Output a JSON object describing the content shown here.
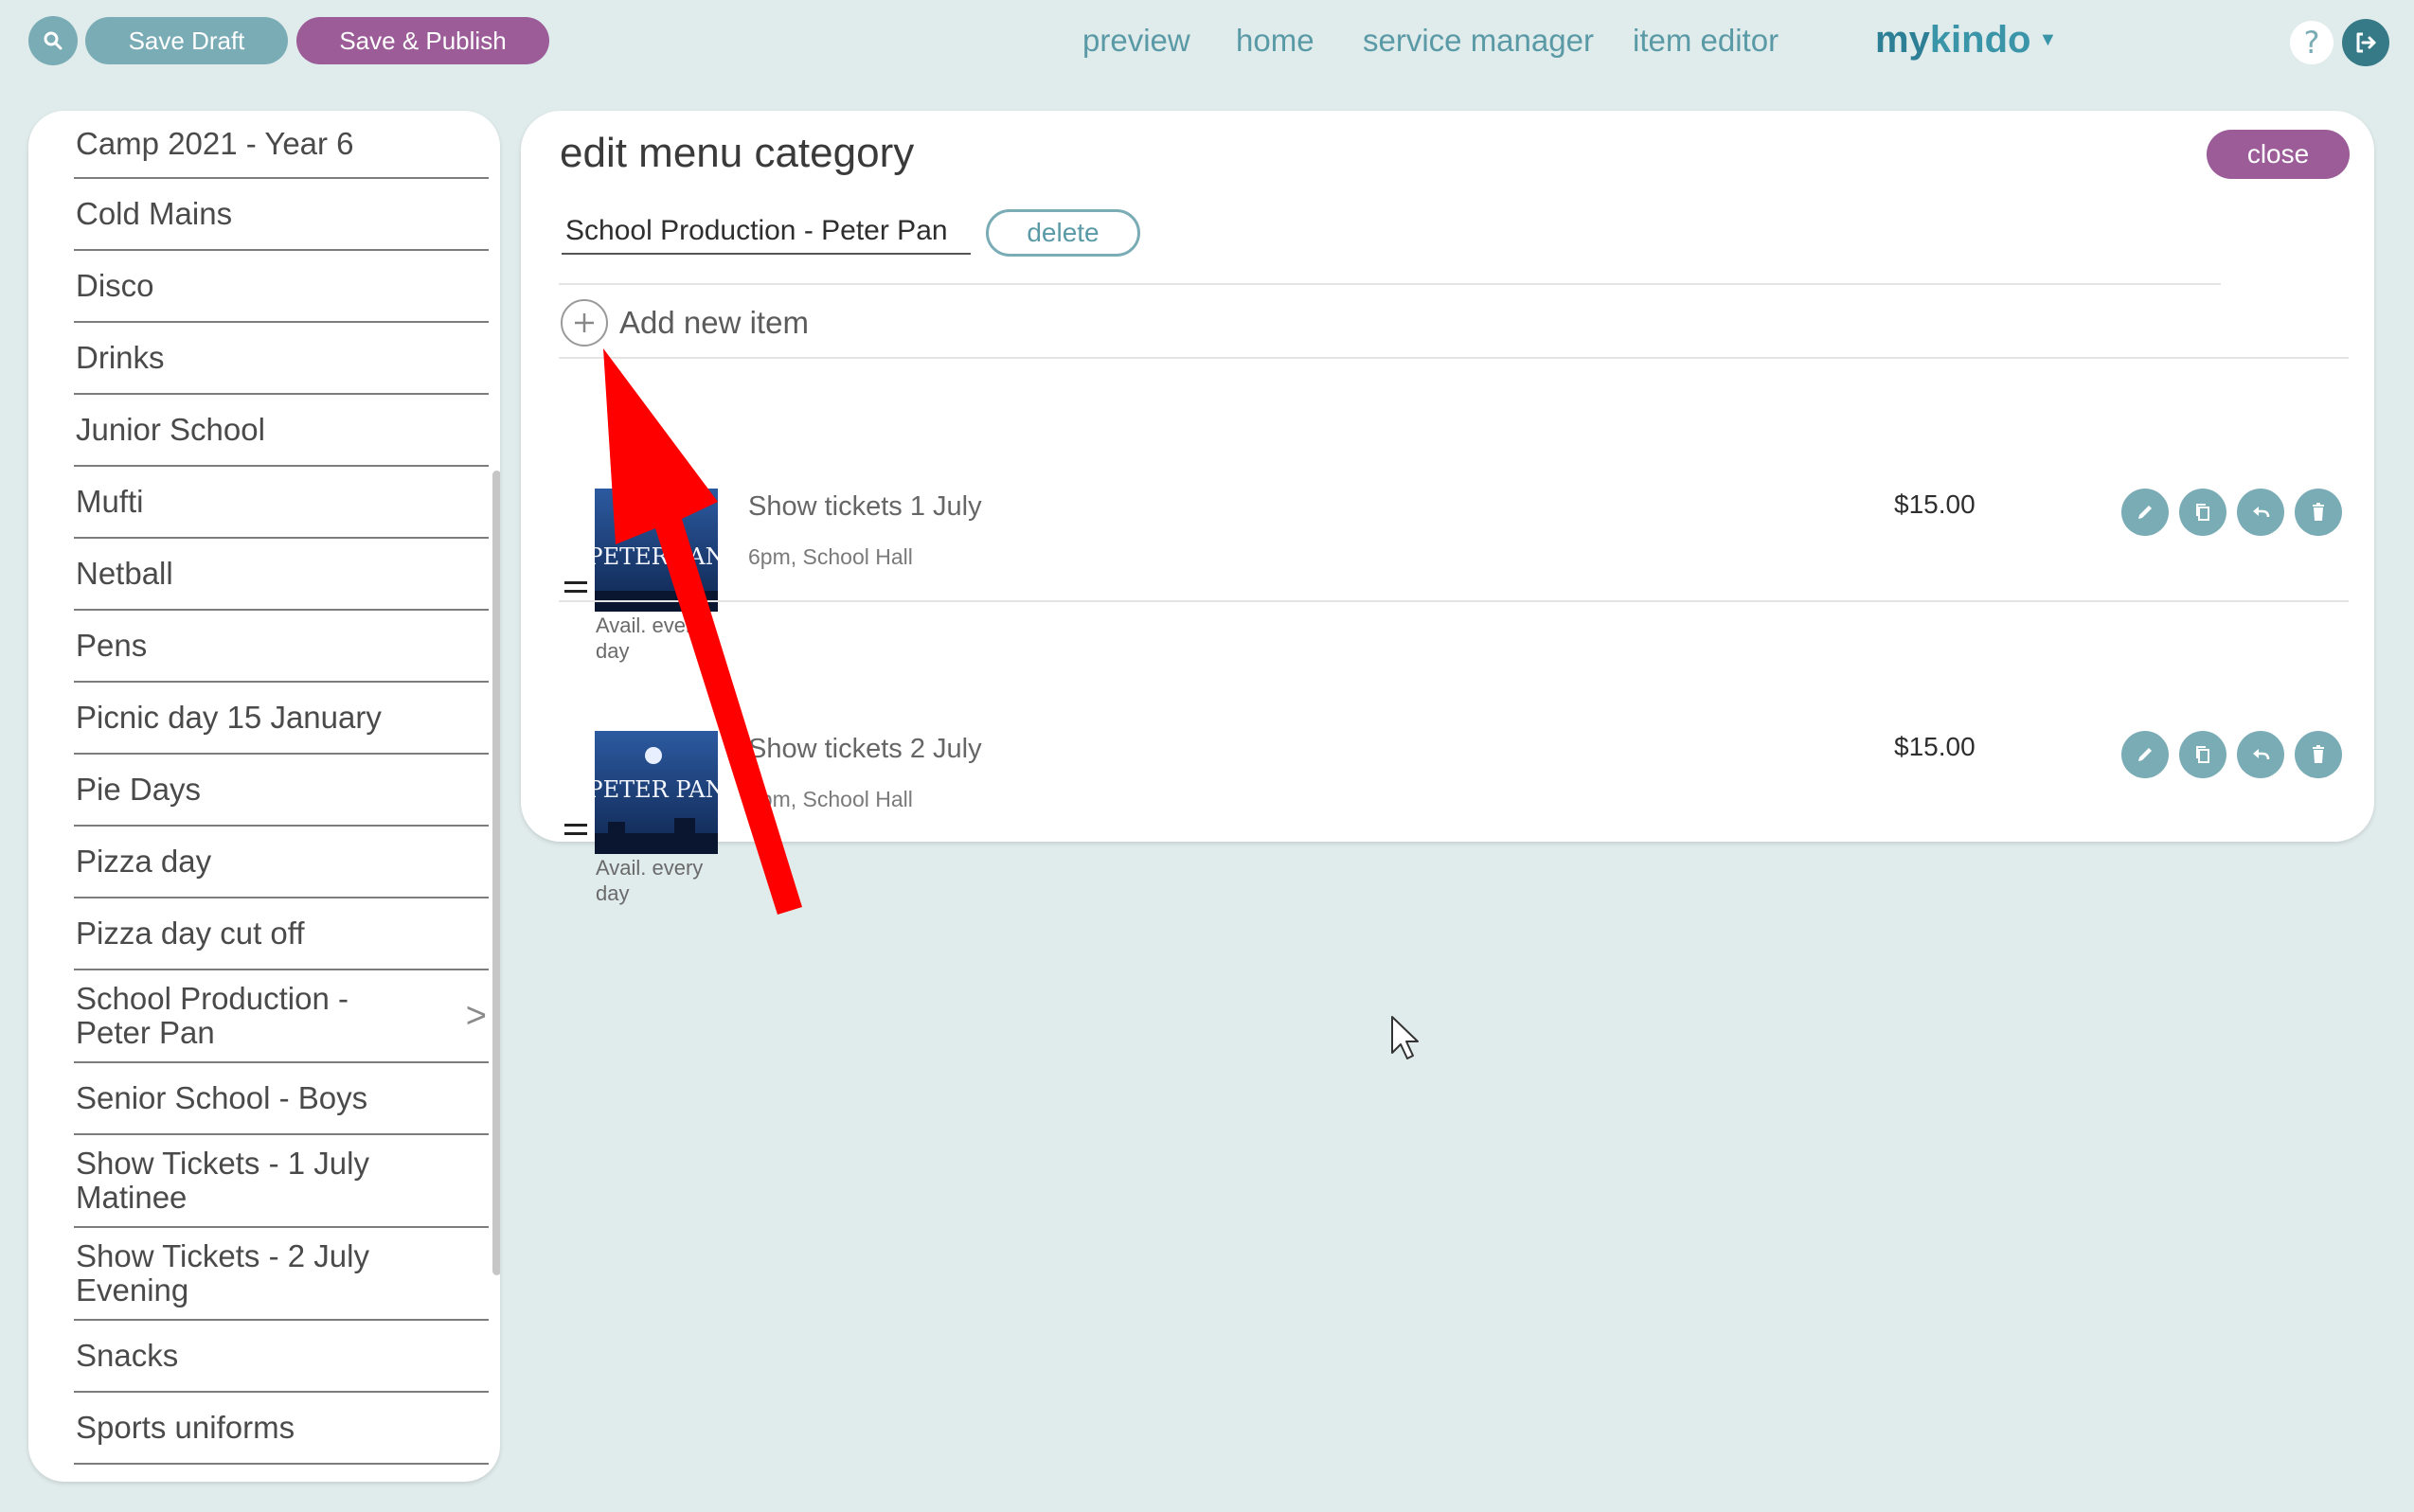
{
  "toolbar": {
    "save_draft": "Save Draft",
    "save_publish": "Save & Publish"
  },
  "nav": {
    "links": [
      "preview",
      "home",
      "service manager",
      "item editor"
    ],
    "brand_my": "my",
    "brand_kindo": "kindo",
    "help": "?"
  },
  "sidebar": {
    "items": [
      "Camp 2021 - Year 6",
      "Cold Mains",
      "Disco",
      "Drinks",
      "Junior School",
      "Mufti",
      "Netball",
      "Pens",
      "Picnic day 15 January",
      "Pie Days",
      "Pizza day",
      "Pizza day cut off",
      "School Production - Peter Pan",
      "Senior School - Boys",
      "Show Tickets - 1 July Matinee",
      "Show Tickets - 2 July Evening",
      "Snacks",
      "Sports uniforms"
    ],
    "selected": "School Production - Peter Pan"
  },
  "editor": {
    "title": "edit menu category",
    "close": "close",
    "category_name": "School Production - Peter Pan",
    "delete": "delete",
    "add_new_item": "Add new item",
    "items": [
      {
        "title": "Show tickets 1 July",
        "subtitle": "6pm, School Hall",
        "price": "$15.00",
        "availability": "Avail. every day",
        "image_text": "PETER PAN"
      },
      {
        "title": "Show tickets 2 July",
        "subtitle": "6pm, School Hall",
        "price": "$15.00",
        "availability": "Avail. every day",
        "image_text": "PETER PAN"
      }
    ]
  },
  "colors": {
    "background": "#e0ebeb",
    "teal": "#7aacb6",
    "purple": "#9b5c98",
    "brand": "#3b95a8",
    "annotation_arrow": "#ff0000"
  },
  "icons": [
    "search-icon",
    "question-icon",
    "logout-icon",
    "plus-icon",
    "drag-handle-icon",
    "edit-icon",
    "copy-icon",
    "undo-icon",
    "trash-icon",
    "chevron-right-icon",
    "cursor-icon"
  ]
}
